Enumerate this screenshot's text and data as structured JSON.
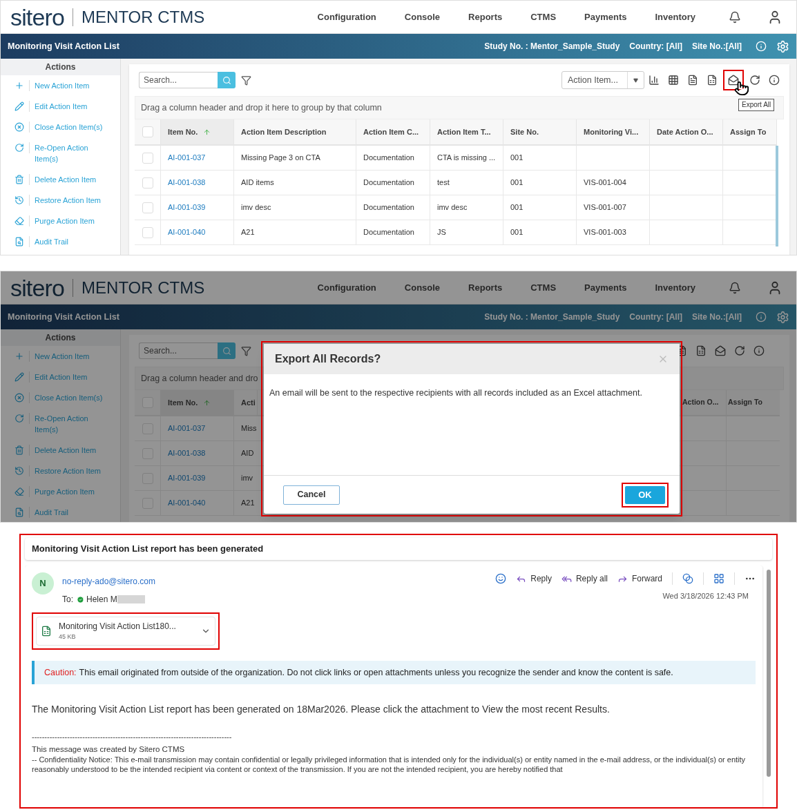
{
  "screen_1": {
    "header": {
      "logo": "sitero",
      "product": "MENTOR CTMS",
      "nav": [
        "Configuration",
        "Console",
        "Reports",
        "CTMS",
        "Payments",
        "Inventory"
      ]
    },
    "title_bar": {
      "title": "Monitoring Visit Action List",
      "study": "Study No. : Mentor_Sample_Study",
      "country": "Country: [All]",
      "site": "Site No.:[All]"
    },
    "sidebar": {
      "heading": "Actions",
      "items": [
        "New Action Item",
        "Edit Action Item",
        "Close Action Item(s)",
        "Re-Open Action Item(s)",
        "Delete Action Item",
        "Restore Action Item",
        "Purge Action Item",
        "Audit Trail"
      ]
    },
    "toolbar": {
      "search_placeholder": "Search...",
      "view_select": "Action Item...",
      "tooltip": "Export All"
    },
    "group_hint": "Drag a column header and drop it here to group by that column",
    "table": {
      "select_all_checked": false,
      "columns": [
        {
          "label": "Item No.",
          "sorted": true
        },
        {
          "label": "Action Item Description"
        },
        {
          "label": "Action Item C..."
        },
        {
          "label": "Action Item T..."
        },
        {
          "label": "Site No."
        },
        {
          "label": "Monitoring Vi..."
        },
        {
          "label": "Date Action O..."
        },
        {
          "label": "Assign To"
        }
      ],
      "rows": [
        {
          "checked": false,
          "item_no": "AI-001-037",
          "description": "Missing Page 3 on CTA",
          "category": "Documentation",
          "type": "CTA is missing ...",
          "site": "001"
        },
        {
          "checked": false,
          "item_no": "AI-001-038",
          "description": "AID items",
          "category": "Documentation",
          "type": "test",
          "site": "001",
          "visit": "VIS-001-004"
        },
        {
          "checked": false,
          "item_no": "AI-001-039",
          "description": "imv desc",
          "category": "Documentation",
          "type": "imv desc",
          "site": "001",
          "visit": "VIS-001-007"
        },
        {
          "checked": false,
          "item_no": "AI-001-040",
          "description": "A21",
          "category": "Documentation",
          "type": "JS",
          "site": "001",
          "visit": "VIS-001-003"
        }
      ]
    }
  },
  "screen_2": {
    "header": {
      "logo": "sitero",
      "product": "MENTOR CTMS",
      "nav": [
        "Configuration",
        "Console",
        "Reports",
        "CTMS",
        "Payments",
        "Inventory"
      ]
    },
    "title_bar": {
      "title": "Monitoring Visit Action List",
      "study": "Study No. : Mentor_Sample_Study",
      "country": "Country: [All]",
      "site": "Site No.:[All]"
    },
    "sidebar": {
      "heading": "Actions",
      "items": [
        "New Action Item",
        "Edit Action Item",
        "Close Action Item(s)",
        "Re-Open Action Item(s)",
        "Delete Action Item",
        "Restore Action Item",
        "Purge Action Item",
        "Audit Trail"
      ]
    },
    "toolbar": {
      "search_placeholder": "Search..."
    },
    "group_hint": "Drag a column header and dro",
    "table": {
      "select_all_checked": false,
      "columns_left": [
        {
          "label": "Item No.",
          "sorted": true
        },
        {
          "label": "Acti"
        }
      ],
      "columns_right": [
        "Action O...",
        "Assign To"
      ],
      "rows": [
        {
          "checked": false,
          "item_no": "AI-001-037",
          "description": "Miss"
        },
        {
          "checked": false,
          "item_no": "AI-001-038",
          "description": "AID"
        },
        {
          "checked": false,
          "item_no": "AI-001-039",
          "description": "imv"
        },
        {
          "checked": false,
          "item_no": "AI-001-040",
          "description": "A21"
        }
      ]
    },
    "dialog": {
      "title": "Export All Records?",
      "message": "An email will be sent to the respective recipients with all records included as an Excel attachment.",
      "buttons": [
        {
          "label": "Cancel",
          "kind": "secondary"
        },
        {
          "label": "OK",
          "kind": "primary"
        }
      ]
    }
  },
  "email": {
    "subject": "Monitoring Visit Action List report has been generated",
    "sender": {
      "initial": "N",
      "address": "no-reply-ado@sitero.com"
    },
    "to_label": "To:",
    "recipient": "Helen M",
    "actions": [
      "Reply",
      "Reply all",
      "Forward"
    ],
    "date": "Wed 3/18/2026 12:43 PM",
    "attachment": {
      "name": "Monitoring Visit Action List180...",
      "size": "45 KB"
    },
    "caution": {
      "label": "Caution:",
      "text": "This email originated from outside of the organization. Do not click links or open attachments unless you recognize the sender and know the content is safe."
    },
    "body": "The Monitoring Visit Action List report has been generated on 18Mar2026. Please click the attachment to View the most recent Results.",
    "rule": "-------------------------------------------------------------------------------",
    "signature": "This message was created by Sitero CTMS",
    "notice": "-- Confidentiality Notice: This e-mail transmission may contain confidential or legally privileged information that is intended only for the individual(s) or entity named in the e-mail address, or the individual(s) or entity reasonably understood to be the intended recipient via content or context of the transmission. If you are not the intended recipient, you are hereby notified that"
  }
}
